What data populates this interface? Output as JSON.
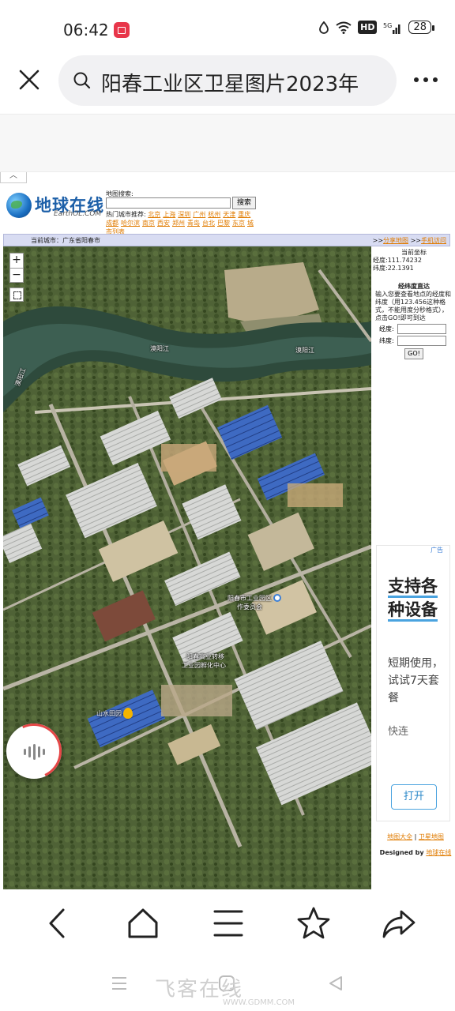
{
  "status": {
    "time": "06:42",
    "network": "5G",
    "battery": "28"
  },
  "search": {
    "query": "阳春工业区卫星图片2023年"
  },
  "site": {
    "logo_text": "地球在线",
    "logo_sub": "EarthOL.COM",
    "search_label": "地图搜索:",
    "search_button": "搜索",
    "hot_label": "热门城市推荐:",
    "hot_cities": [
      "北京",
      "上海",
      "深圳",
      "广州",
      "杭州",
      "天津",
      "重庆",
      "成都",
      "哈尔滨",
      "南京",
      "西安",
      "郑州",
      "青岛",
      "台北",
      "巴黎",
      "东京",
      "城市列表"
    ],
    "current_city_label": "当前城市：广东省阳春市",
    "share_link": "分享地图",
    "mobile_link": "手机访问"
  },
  "map": {
    "labels": {
      "river1": "漠阳江",
      "river2": "漠阳江",
      "river3": "漠阳江",
      "park": "阳春市工业园区",
      "park_sub": "作委员会",
      "incubator": "阳春高业转移",
      "incubator_sub": "工业园孵化中心",
      "shanshui": "山水田园"
    }
  },
  "side": {
    "coord_title": "当前坐标",
    "longitude": "经度:111.74232",
    "latitude": "纬度:22.1391",
    "direct_title": "经纬度直达",
    "instructions": "输入您要查看地点的经度和纬度（用123.456这种格式，不能用度分秒格式），点击GO!即可到达",
    "lng_label": "经度:",
    "lat_label": "纬度:",
    "go_label": "GO!"
  },
  "ad": {
    "tag": "广告",
    "title": "支持各种设备",
    "body": "短期使用，试试7天套餐",
    "sub": "快连",
    "button": "打开"
  },
  "footer": {
    "link1": "地图大全",
    "link2": "卫星地图",
    "designed_by": "Designed by ",
    "designer": "地球在线"
  },
  "watermark": {
    "text": "飞客在线",
    "sub": "WWW.GDMM.COM"
  }
}
